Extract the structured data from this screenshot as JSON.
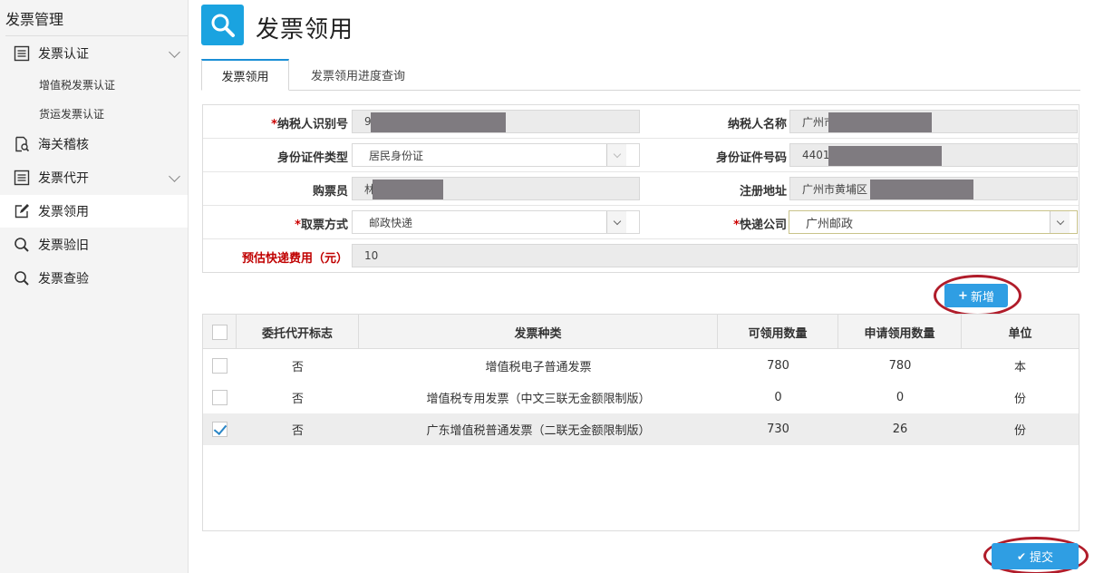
{
  "sidebar": {
    "title": "发票管理",
    "items": [
      {
        "label": "发票认证",
        "icon": "list-icon"
      },
      {
        "label": "海关稽核",
        "icon": "doc-search-icon"
      },
      {
        "label": "发票代开",
        "icon": "list-icon"
      },
      {
        "label": "发票领用",
        "icon": "edit-icon"
      },
      {
        "label": "发票验旧",
        "icon": "search-icon"
      },
      {
        "label": "发票查验",
        "icon": "search-icon"
      }
    ],
    "sub_items": [
      "增值税发票认证",
      "货运发票认证"
    ]
  },
  "header": {
    "title": "发票领用",
    "icon": "search-icon",
    "icon_color": "#1aa3e0"
  },
  "tabs": [
    {
      "label": "发票领用"
    },
    {
      "label": "发票领用进度查询"
    }
  ],
  "form": {
    "taxpayer_id": {
      "label": "纳税人识别号",
      "value": "9"
    },
    "taxpayer_name": {
      "label": "纳税人名称",
      "value": "广州市"
    },
    "id_type": {
      "label": "身份证件类型",
      "value": "居民身份证"
    },
    "id_number": {
      "label": "身份证件号码",
      "value": "4401"
    },
    "buyer": {
      "label": "购票员",
      "value": "林"
    },
    "reg_address": {
      "label": "注册地址",
      "value": "广州市黄埔区"
    },
    "pickup_method": {
      "label": "取票方式",
      "value": "邮政快递"
    },
    "courier": {
      "label": "快递公司",
      "value": "广州邮政"
    },
    "fee": {
      "label": "预估快递费用（元）",
      "value": "10"
    },
    "required_mark": "*"
  },
  "buttons": {
    "add": "新增",
    "submit": "提交"
  },
  "table": {
    "headers": [
      "委托代开标志",
      "发票种类",
      "可领用数量",
      "申请领用数量",
      "单位"
    ],
    "rows": [
      {
        "delegate": "否",
        "type": "增值税电子普通发票",
        "available": "780",
        "requested": "780",
        "unit": "本",
        "checked": false
      },
      {
        "delegate": "否",
        "type": "增值税专用发票（中文三联无金额限制版）",
        "available": "0",
        "requested": "0",
        "unit": "份",
        "checked": false
      },
      {
        "delegate": "否",
        "type": "广东增值税普通发票（二联无金额限制版）",
        "available": "730",
        "requested": "26",
        "unit": "份",
        "checked": true
      }
    ]
  },
  "colors": {
    "accent": "#2f9ee3",
    "annotation_ring": "#b01c2a",
    "required": "#c00000"
  }
}
